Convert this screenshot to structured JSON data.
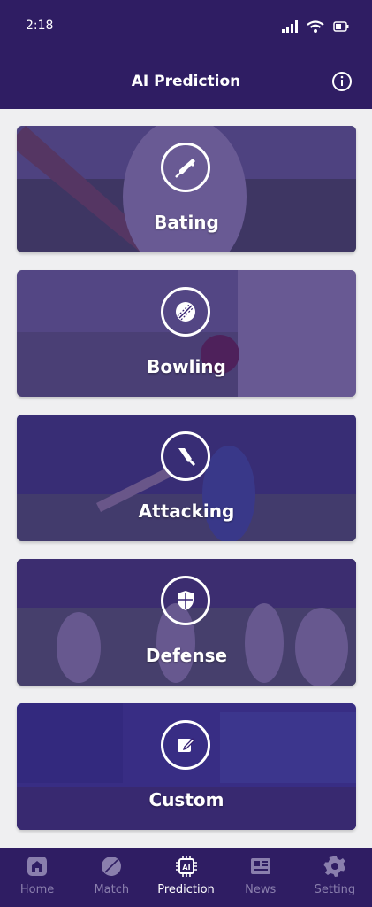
{
  "status": {
    "time": "2:18"
  },
  "header": {
    "title": "AI Prediction"
  },
  "cards": [
    {
      "label": "Bating",
      "icon": "bat-icon"
    },
    {
      "label": "Bowling",
      "icon": "cricket-ball-icon"
    },
    {
      "label": "Attacking",
      "icon": "bat-icon"
    },
    {
      "label": "Defense",
      "icon": "shield-icon"
    },
    {
      "label": "Custom",
      "icon": "edit-icon"
    }
  ],
  "nav": {
    "items": [
      {
        "label": "Home",
        "icon": "home-icon",
        "active": false
      },
      {
        "label": "Match",
        "icon": "cricket-ball-icon",
        "active": false
      },
      {
        "label": "Prediction",
        "icon": "ai-chip-icon",
        "active": true
      },
      {
        "label": "News",
        "icon": "newspaper-icon",
        "active": false
      },
      {
        "label": "Setting",
        "icon": "gear-icon",
        "active": false
      }
    ]
  },
  "colors": {
    "primary": "#2f1d63",
    "overlay": "#372373",
    "background": "#efeff1"
  }
}
